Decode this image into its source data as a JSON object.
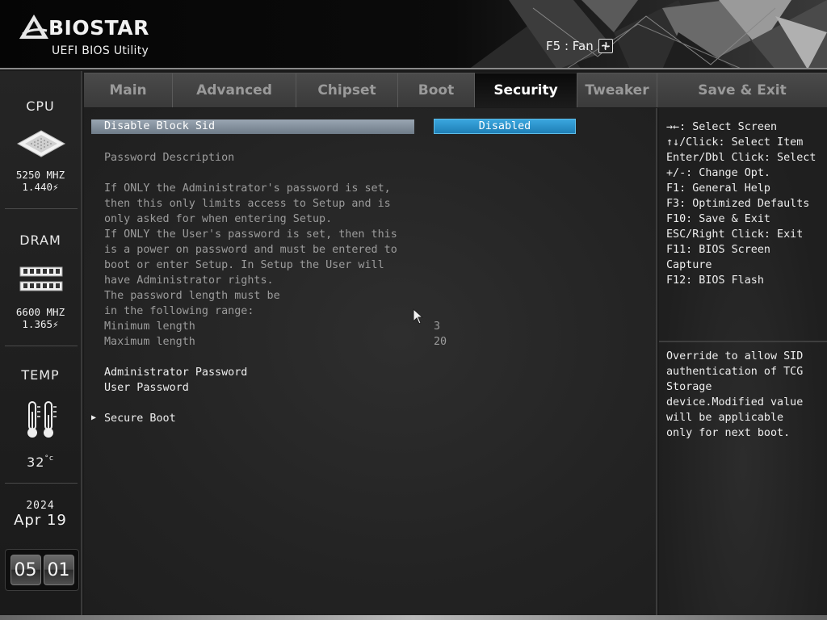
{
  "header": {
    "brand": "BIOSTAR",
    "subtitle": "UEFI BIOS Utility",
    "fan_hint": "F5 : Fan",
    "icons": {
      "logo": "biostar-logo-icon",
      "fan": "fan-icon"
    }
  },
  "sidebar": {
    "cpu": {
      "label": "CPU",
      "freq": "5250 MHZ",
      "voltage": "1.440"
    },
    "dram": {
      "label": "DRAM",
      "freq": "6600 MHZ",
      "voltage": "1.365"
    },
    "temp": {
      "label": "TEMP",
      "value": "32"
    },
    "date": {
      "year": "2024",
      "month_day": "Apr  19"
    },
    "clock": {
      "hour": "05",
      "minute": "01"
    }
  },
  "tabs": [
    {
      "label": "Main"
    },
    {
      "label": "Advanced"
    },
    {
      "label": "Chipset"
    },
    {
      "label": "Boot"
    },
    {
      "label": "Security",
      "active": true
    },
    {
      "label": "Tweaker"
    },
    {
      "label": "Save & Exit"
    }
  ],
  "main": {
    "selected_item": {
      "label": "Disable Block Sid",
      "value": "Disabled"
    },
    "password_description_title": "Password Description",
    "description_lines": [
      "If ONLY the Administrator's password is set,",
      "then this only limits access to Setup and is",
      "only asked for when entering Setup.",
      "If ONLY the User's password is set, then this",
      "is a power on password and must be entered to",
      "boot or enter Setup. In Setup the User will",
      "have Administrator rights.",
      "The password length must be",
      "in the following range:"
    ],
    "min_length": {
      "label": "Minimum length",
      "value": "3"
    },
    "max_length": {
      "label": "Maximum length",
      "value": "20"
    },
    "admin_password": "Administrator Password",
    "user_password": "User Password",
    "secure_boot": "Secure Boot"
  },
  "help": {
    "keys": [
      "→←: Select Screen",
      "↑↓/Click: Select Item",
      "Enter/Dbl Click: Select",
      "+/-: Change Opt.",
      "F1: General Help",
      "F3: Optimized Defaults",
      "F10: Save & Exit",
      "ESC/Right Click: Exit",
      "F11: BIOS Screen",
      "Capture",
      "F12: BIOS Flash"
    ],
    "description": [
      "Override to allow SID",
      "authentication of TCG",
      "Storage",
      "device.Modified value",
      "will be applicable",
      "only for next boot."
    ]
  },
  "colors": {
    "selected_bar": "#7f8c99",
    "value_box": "#2a92cc",
    "active_tab": "#101010",
    "inactive_tab": "#424242"
  }
}
